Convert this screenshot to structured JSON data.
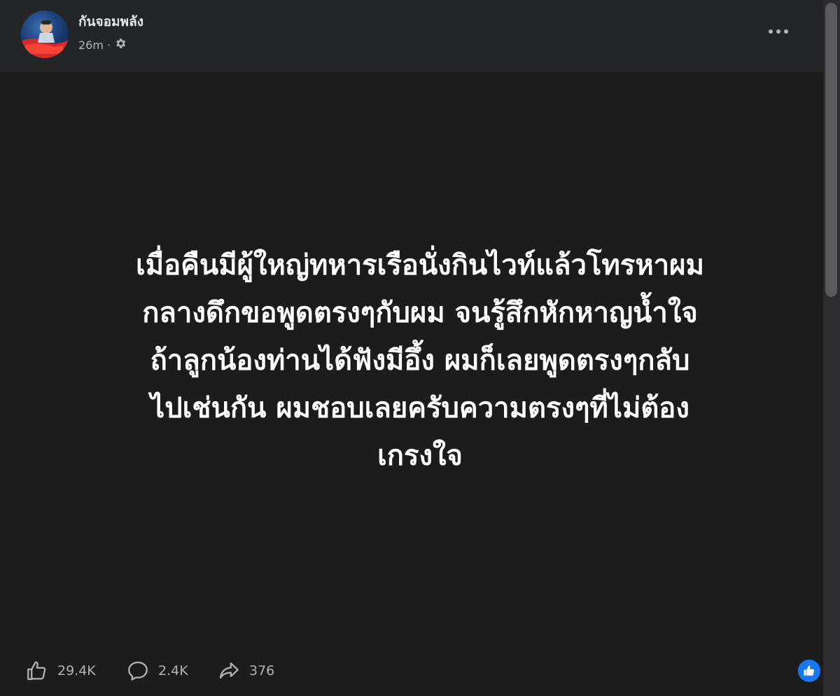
{
  "post": {
    "author": "กันจอมพลัง",
    "time": "26m",
    "meta_separator": "·",
    "text": "เมื่อคืนมีผู้ใหญ่ทหารเรือนั่งกินไวท์แล้วโทรหาผม\nกลางดึกขอพูดตรงๆกับผม จนรู้สึกหักหาญน้ำใจ\nถ้าลูกน้องท่านได้ฟังมีอึ้ง ผมก็เลยพูดตรงๆกลับ\nไปเช่นกัน ผมชอบเลยครับความตรงๆที่ไม่ต้อง\nเกรงใจ",
    "audience_icon": "gear-icon"
  },
  "actions": {
    "likes": "29.4K",
    "comments": "2.4K",
    "shares": "376"
  },
  "colors": {
    "page_bg": "#1c1c1d",
    "header_bg": "#242526",
    "text_primary": "#ffffff",
    "text_secondary": "#b0b3b8",
    "accent": "#1877f2"
  }
}
